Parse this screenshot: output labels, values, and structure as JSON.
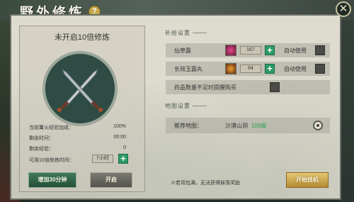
{
  "header": {
    "title": "野外修炼",
    "help_label": "?",
    "close_label": "✕"
  },
  "left": {
    "title": "未开启10倍修炼",
    "stats": [
      {
        "label": "当前篝火经验加成：",
        "value": "100%"
      },
      {
        "label": "剩余时间：",
        "value": "00:00"
      },
      {
        "label": "剩余经验：",
        "value": "0"
      }
    ],
    "hours_label": "可用10倍修炼时间：",
    "hours_value": "7小时",
    "add_time_button": "增加30分钟",
    "start_button": "开启"
  },
  "supply": {
    "section_title": "补给设置",
    "items": [
      {
        "name": "仙草露",
        "count": "167",
        "auto_label": "自动使用",
        "icon": "pink-potion-icon"
      },
      {
        "name": "长效玉露丸",
        "count": "64",
        "auto_label": "自动使用",
        "icon": "orange-pill-icon"
      }
    ],
    "low_reminder_label": "药品数量不足时提醒购买"
  },
  "map": {
    "section_title": "地图设置",
    "recommend_label": "推荐地图：",
    "place": "沙漠山洞",
    "level": "100级"
  },
  "footer": {
    "note": "※若背包满，无法获得掉落奖励",
    "start_hangup_button": "开始挂机"
  },
  "colors": {
    "accent_green": "#2c9b68",
    "level_green": "#1fa04a",
    "gold_button": "#d8b75c"
  }
}
